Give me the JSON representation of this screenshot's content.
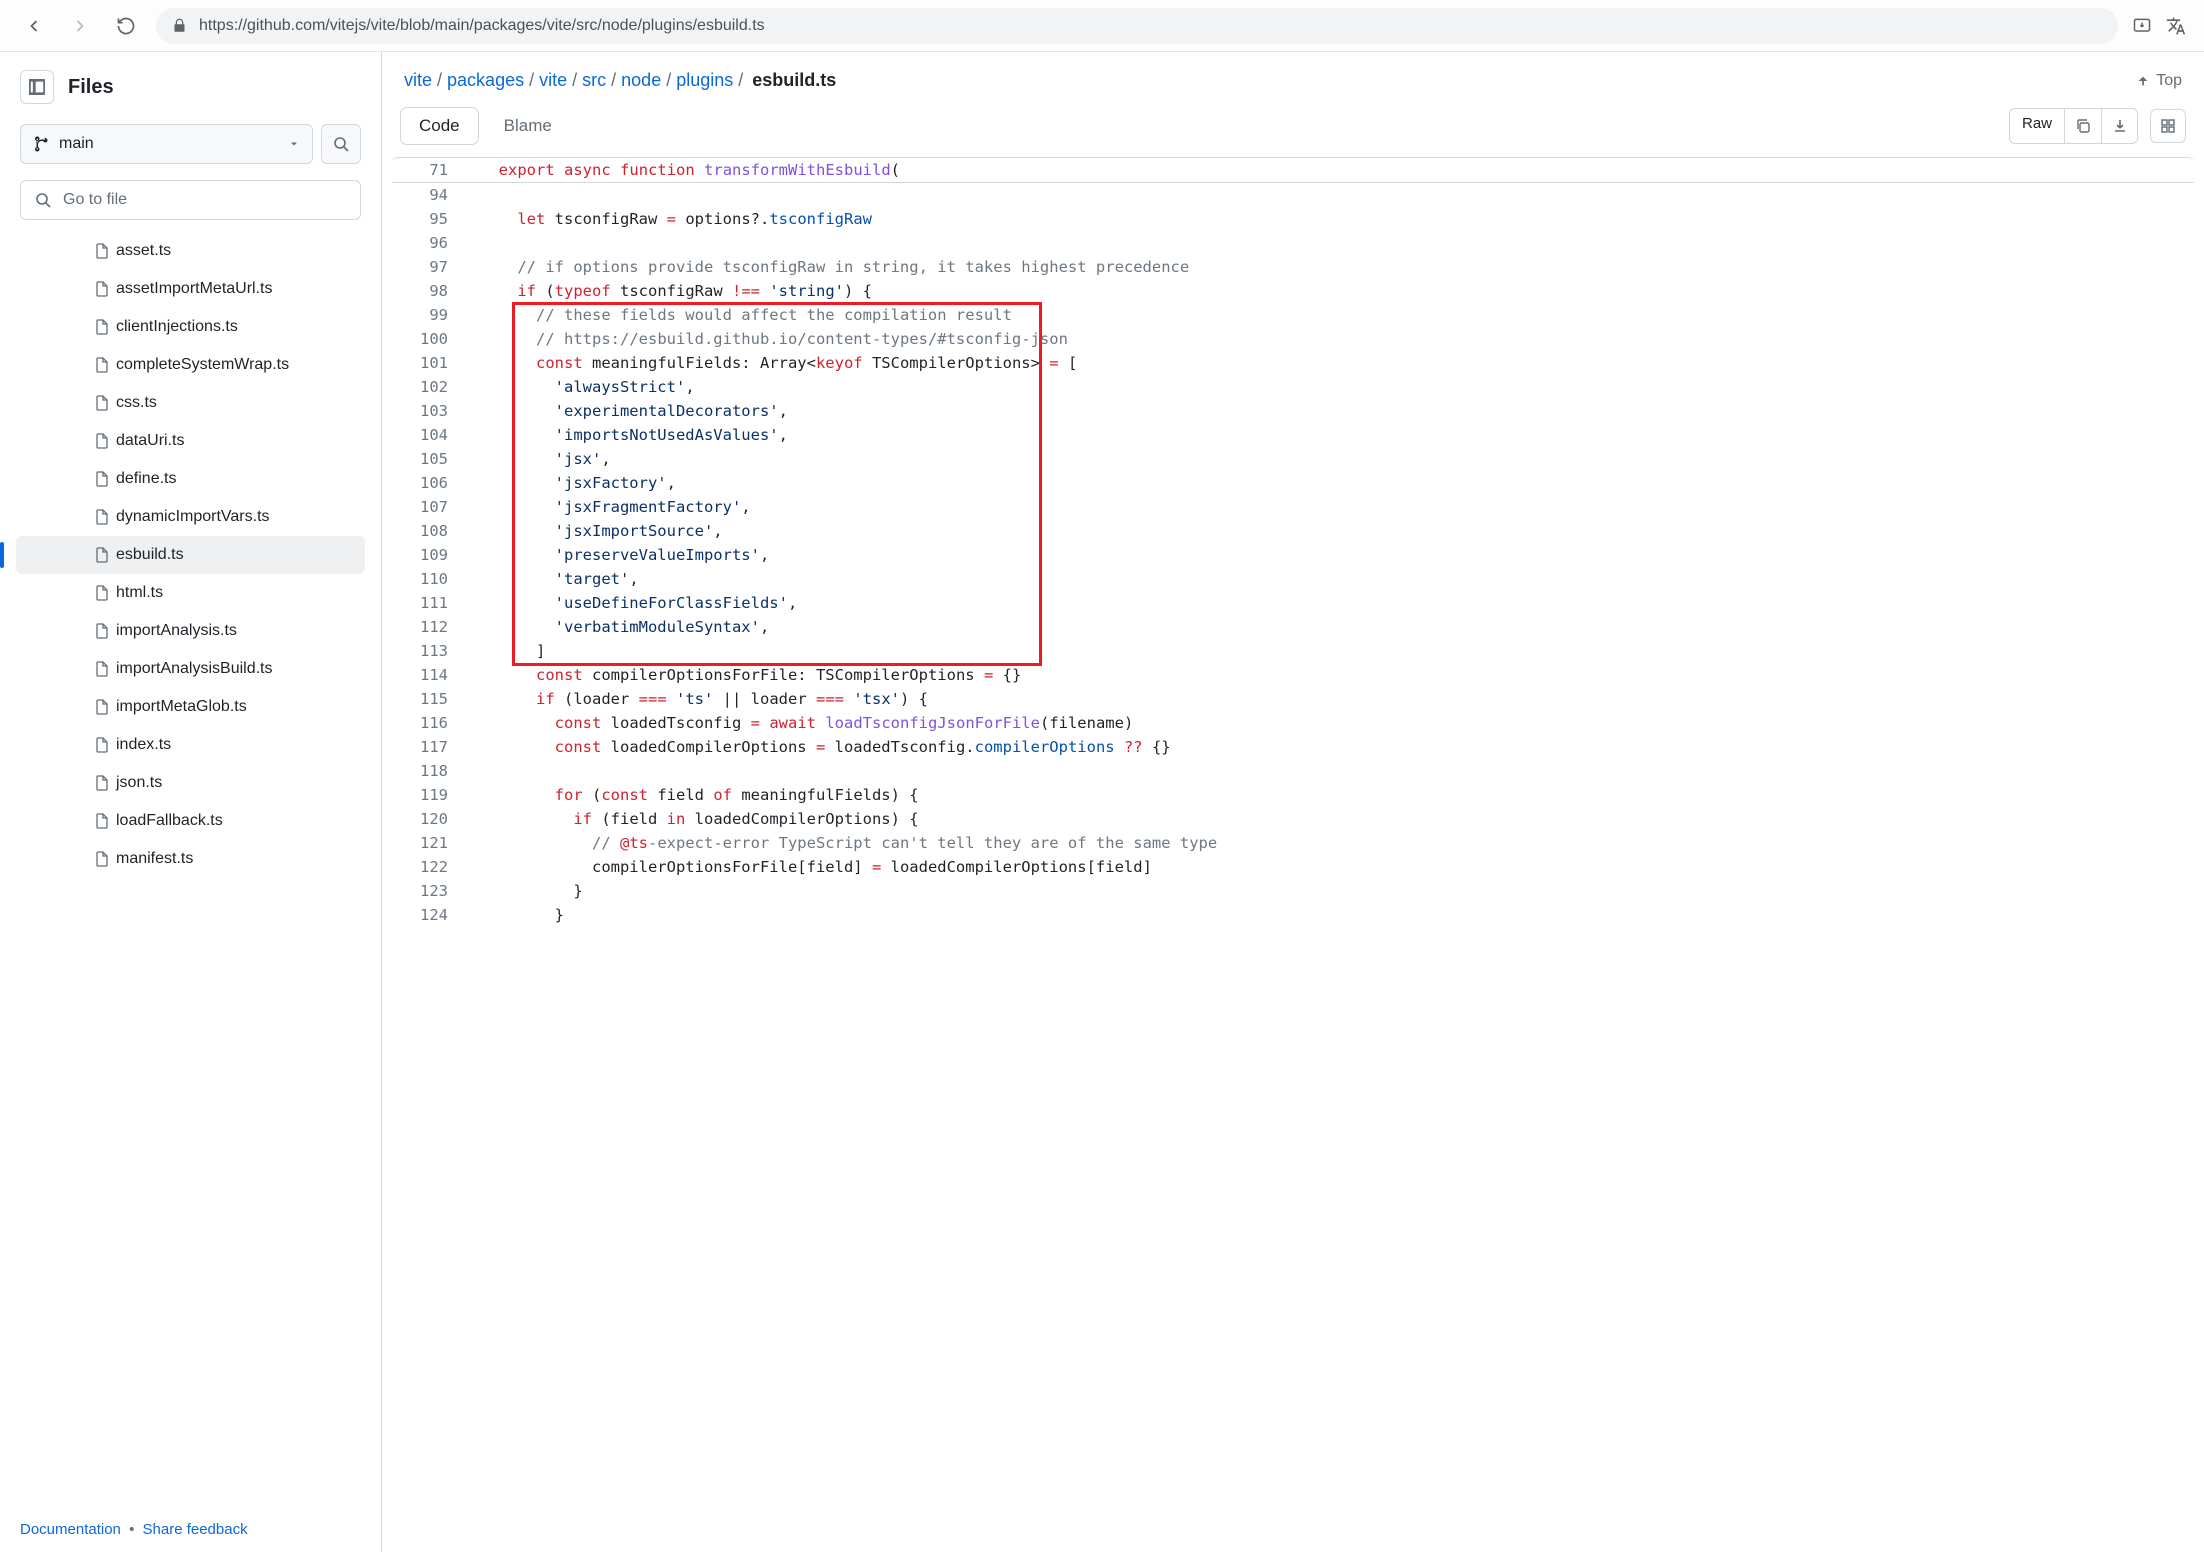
{
  "browser": {
    "url": "https://github.com/vitejs/vite/blob/main/packages/vite/src/node/plugins/esbuild.ts"
  },
  "sidebar": {
    "title": "Files",
    "branch": "main",
    "goto_placeholder": "Go to file",
    "files": [
      {
        "name": "asset.ts"
      },
      {
        "name": "assetImportMetaUrl.ts"
      },
      {
        "name": "clientInjections.ts"
      },
      {
        "name": "completeSystemWrap.ts"
      },
      {
        "name": "css.ts"
      },
      {
        "name": "dataUri.ts"
      },
      {
        "name": "define.ts"
      },
      {
        "name": "dynamicImportVars.ts"
      },
      {
        "name": "esbuild.ts",
        "active": true
      },
      {
        "name": "html.ts"
      },
      {
        "name": "importAnalysis.ts"
      },
      {
        "name": "importAnalysisBuild.ts"
      },
      {
        "name": "importMetaGlob.ts"
      },
      {
        "name": "index.ts"
      },
      {
        "name": "json.ts"
      },
      {
        "name": "loadFallback.ts"
      },
      {
        "name": "manifest.ts"
      }
    ],
    "footer": {
      "documentation": "Documentation",
      "share_feedback": "Share feedback"
    }
  },
  "breadcrumb": {
    "parts": [
      "vite",
      "packages",
      "vite",
      "src",
      "node",
      "plugins"
    ],
    "current": "esbuild.ts",
    "top_label": "Top"
  },
  "toolbar": {
    "tabs": {
      "code": "Code",
      "blame": "Blame"
    },
    "raw": "Raw"
  },
  "code": {
    "sticky": {
      "num": "71",
      "html": "  <span class='kw'>export</span> <span class='kw'>async</span> <span class='kw'>function</span> <span class='fn'>transformWithEsbuild</span>("
    },
    "lines": [
      {
        "num": "94",
        "html": ""
      },
      {
        "num": "95",
        "html": "    <span class='kw'>let</span> tsconfigRaw <span class='op'>=</span> options?.<span class='prop'>tsconfigRaw</span>"
      },
      {
        "num": "96",
        "html": ""
      },
      {
        "num": "97",
        "html": "    <span class='cmt'>// if options provide tsconfigRaw in string, it takes highest precedence</span>"
      },
      {
        "num": "98",
        "html": "    <span class='kw'>if</span> (<span class='kw'>typeof</span> tsconfigRaw <span class='op'>!==</span> <span class='str'>'string'</span>) {"
      },
      {
        "num": "99",
        "html": "      <span class='cmt'>// these fields would affect the compilation result</span>"
      },
      {
        "num": "100",
        "html": "      <span class='cmt'>// https://esbuild.github.io/content-types/#tsconfig-json</span>"
      },
      {
        "num": "101",
        "html": "      <span class='kw'>const</span> meaningfulFields: Array&lt;<span class='kw'>keyof</span> TSCompilerOptions&gt; <span class='op'>=</span> ["
      },
      {
        "num": "102",
        "html": "        <span class='str'>'alwaysStrict'</span>,"
      },
      {
        "num": "103",
        "html": "        <span class='str'>'experimentalDecorators'</span>,"
      },
      {
        "num": "104",
        "html": "        <span class='str'>'importsNotUsedAsValues'</span>,"
      },
      {
        "num": "105",
        "html": "        <span class='str'>'jsx'</span>,"
      },
      {
        "num": "106",
        "html": "        <span class='str'>'jsxFactory'</span>,"
      },
      {
        "num": "107",
        "html": "        <span class='str'>'jsxFragmentFactory'</span>,"
      },
      {
        "num": "108",
        "html": "        <span class='str'>'jsxImportSource'</span>,"
      },
      {
        "num": "109",
        "html": "        <span class='str'>'preserveValueImports'</span>,"
      },
      {
        "num": "110",
        "html": "        <span class='str'>'target'</span>,"
      },
      {
        "num": "111",
        "html": "        <span class='str'>'useDefineForClassFields'</span>,"
      },
      {
        "num": "112",
        "html": "        <span class='str'>'verbatimModuleSyntax'</span>,"
      },
      {
        "num": "113",
        "html": "      ]"
      },
      {
        "num": "114",
        "html": "      <span class='kw'>const</span> compilerOptionsForFile: TSCompilerOptions <span class='op'>=</span> {}"
      },
      {
        "num": "115",
        "html": "      <span class='kw'>if</span> (loader <span class='op'>===</span> <span class='str'>'ts'</span> || loader <span class='op'>===</span> <span class='str'>'tsx'</span>) {"
      },
      {
        "num": "116",
        "html": "        <span class='kw'>const</span> loadedTsconfig <span class='op'>=</span> <span class='kw'>await</span> <span class='fn'>loadTsconfigJsonForFile</span>(filename)"
      },
      {
        "num": "117",
        "html": "        <span class='kw'>const</span> loadedCompilerOptions <span class='op'>=</span> loadedTsconfig.<span class='prop'>compilerOptions</span> <span class='op'>??</span> {}"
      },
      {
        "num": "118",
        "html": ""
      },
      {
        "num": "119",
        "html": "        <span class='kw'>for</span> (<span class='kw'>const</span> field <span class='kw'>of</span> meaningfulFields) {"
      },
      {
        "num": "120",
        "html": "          <span class='kw'>if</span> (field <span class='kw'>in</span> loadedCompilerOptions) {"
      },
      {
        "num": "121",
        "html": "            <span class='cmt'>// <span style='color:#cf222e'>@ts</span>-expect-error TypeScript can't tell they are of the same type</span>"
      },
      {
        "num": "122",
        "html": "            compilerOptionsForFile[field] <span class='op'>=</span> loadedCompilerOptions[field]"
      },
      {
        "num": "123",
        "html": "          }"
      },
      {
        "num": "124",
        "html": "        }"
      }
    ],
    "highlight": {
      "start": "99",
      "end": "113"
    }
  }
}
